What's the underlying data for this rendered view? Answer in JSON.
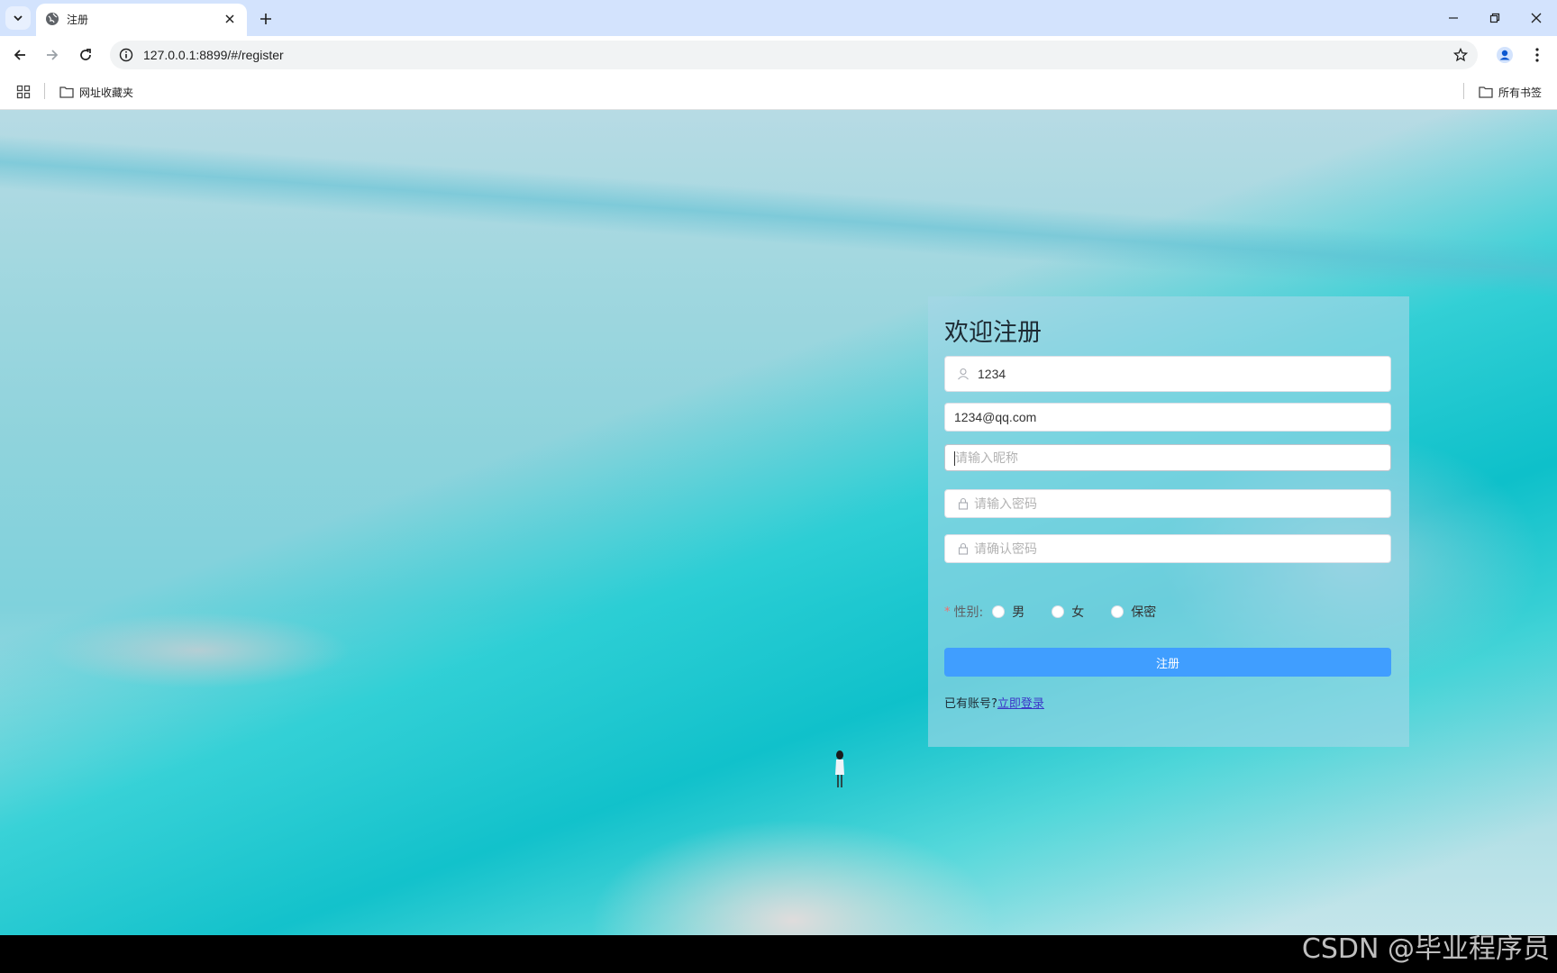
{
  "browser": {
    "tab_title": "注册",
    "url": "127.0.0.1:8899/#/register",
    "bookmarks": {
      "folder_label": "网址收藏夹",
      "all_bookmarks_label": "所有书签"
    }
  },
  "register": {
    "title": "欢迎注册",
    "username_value": "1234",
    "email_value": "1234@qq.com",
    "nickname_placeholder": "请输入昵称",
    "password_placeholder": "请输入密码",
    "confirm_placeholder": "请确认密码",
    "gender_required_mark": "*",
    "gender_label": "性别:",
    "gender_options": [
      "男",
      "女",
      "保密"
    ],
    "submit_label": "注册",
    "login_prompt": "已有账号?",
    "login_link": "立即登录"
  },
  "watermark": "CSDN @毕业程序员",
  "colors": {
    "primary": "#409eff",
    "tab_strip": "#d3e3fd",
    "link": "#3b35c8",
    "required": "#f56c6c"
  },
  "icons": {
    "username": "user-icon",
    "password": "lock-icon",
    "confirm": "lock-icon"
  }
}
